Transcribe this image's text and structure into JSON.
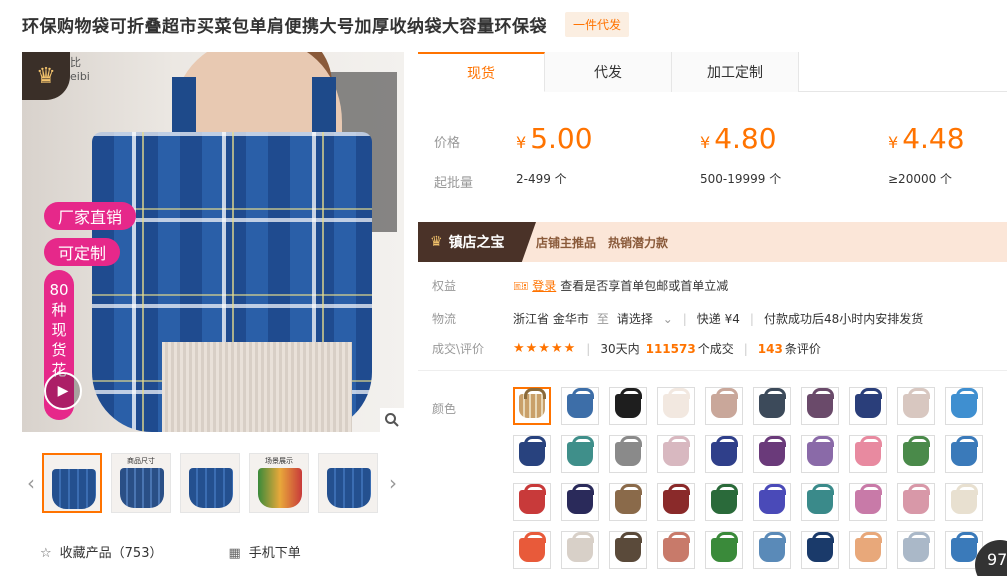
{
  "title": "环保购物袋可折叠超市买菜包单肩便携大号加厚收纳袋大容量环保袋",
  "badge": "一件代发",
  "image": {
    "logo_text": "比\neibi",
    "promo1": "厂家直销",
    "promo2": "可定制",
    "promo3": "80种现货花色"
  },
  "thumbs": [
    {
      "label": ""
    },
    {
      "label": "商品尺寸"
    },
    {
      "label": ""
    },
    {
      "label": "场景展示"
    },
    {
      "label": ""
    }
  ],
  "bottom": {
    "favorite": "收藏产品（753）",
    "mobile": "手机下单"
  },
  "tabs": [
    "现货",
    "代发",
    "加工定制"
  ],
  "price_label": "价格",
  "moq_label": "起批量",
  "prices": [
    {
      "currency": "¥",
      "value": "5.00",
      "range": "2-499 个"
    },
    {
      "currency": "¥",
      "value": "4.80",
      "range": "500-19999 个"
    },
    {
      "currency": "¥",
      "value": "4.48",
      "range": "≥20000 个"
    }
  ],
  "shop": {
    "tag": "镇店之宝",
    "recommend": "店铺主推品",
    "hot": "热销潜力款"
  },
  "benefits": {
    "label": "权益",
    "login": "登录",
    "text": "查看是否享首单包邮或首单立减"
  },
  "logistics": {
    "label": "物流",
    "from": "浙江省 金华市",
    "to": "至",
    "select": "请选择",
    "express": "快递 ¥4",
    "ship": "付款成功后48小时内安排发货"
  },
  "reviews": {
    "label": "成交\\评价",
    "stars": "★★★★★",
    "prefix": "30天内",
    "deals": "111573",
    "deals_suffix": "个成交",
    "count": "143",
    "count_suffix": "条评价"
  },
  "color_label": "颜色",
  "swatch_colors": [
    "#6b8fb8",
    "#3d6ea8",
    "#1e1e1e",
    "#f2e8e0",
    "#c9a79a",
    "#3c4a5a",
    "#6a4a6a",
    "#2a3e7a",
    "#d8c7c0",
    "#3f8fd0",
    "#28427e",
    "#3f8f8a",
    "#8a8a8a",
    "#d8b8c0",
    "#2f3f8a",
    "#6a3a7a",
    "#8a6aa8",
    "#e88aa0",
    "#4a8a4a",
    "#3a7aba",
    "#c83a3a",
    "#2a2a5a",
    "#8a6a4a",
    "#8a2a2a",
    "#2a6a3a",
    "#4a4ab8",
    "#3a8a8a",
    "#c87aa8",
    "#d898a8",
    "#e8e0d0",
    "#e85a3a",
    "#d8d0c8",
    "#5a4a3a",
    "#c87a6a",
    "#3a8a3a",
    "#5a8ab8",
    "#1a3a6a",
    "#e8a87a",
    "#aab8c8",
    "#3a7aba"
  ],
  "corner": "97"
}
